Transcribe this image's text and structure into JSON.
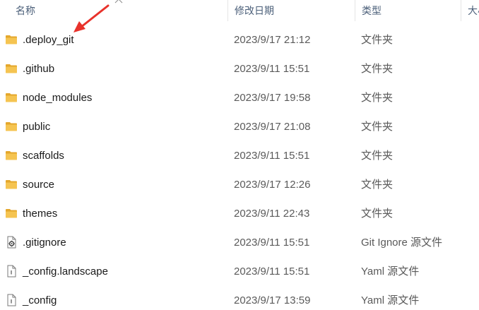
{
  "columns": {
    "name": "名称",
    "date_modified": "修改日期",
    "type": "类型",
    "size": "大小"
  },
  "colors": {
    "folder": "#f5c451",
    "folder_dark": "#e4a72c",
    "annotation_arrow": "#e8322b",
    "header_text": "#4c607a"
  },
  "files": [
    {
      "name": ".deploy_git",
      "date": "2023/9/17 21:12",
      "type": "文件夹",
      "icon": "folder-icon"
    },
    {
      "name": ".github",
      "date": "2023/9/11 15:51",
      "type": "文件夹",
      "icon": "folder-icon"
    },
    {
      "name": "node_modules",
      "date": "2023/9/17 19:58",
      "type": "文件夹",
      "icon": "folder-icon"
    },
    {
      "name": "public",
      "date": "2023/9/17 21:08",
      "type": "文件夹",
      "icon": "folder-icon"
    },
    {
      "name": "scaffolds",
      "date": "2023/9/11 15:51",
      "type": "文件夹",
      "icon": "folder-icon"
    },
    {
      "name": "source",
      "date": "2023/9/17 12:26",
      "type": "文件夹",
      "icon": "folder-icon"
    },
    {
      "name": "themes",
      "date": "2023/9/11 22:43",
      "type": "文件夹",
      "icon": "folder-icon"
    },
    {
      "name": ".gitignore",
      "date": "2023/9/11 15:51",
      "type": "Git Ignore 源文件",
      "icon": "settings-file-icon"
    },
    {
      "name": "_config.landscape",
      "date": "2023/9/11 15:51",
      "type": "Yaml 源文件",
      "icon": "document-file-icon"
    },
    {
      "name": "_config",
      "date": "2023/9/17 13:59",
      "type": "Yaml 源文件",
      "icon": "document-file-icon"
    }
  ]
}
